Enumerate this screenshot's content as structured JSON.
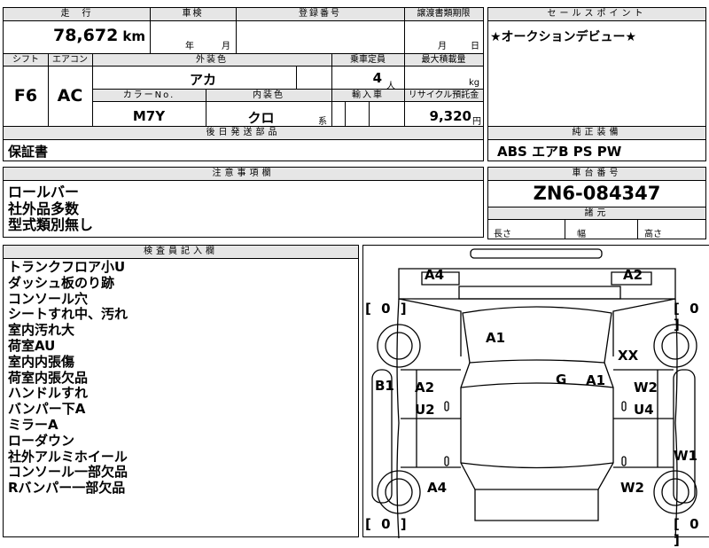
{
  "top": {
    "mileage_header": "走　行",
    "mileage_value": "78,672",
    "mileage_unit": "km",
    "inspection_header": "車検",
    "inspection_year_unit": "年",
    "inspection_month_unit": "月",
    "registration_header": "登録番号",
    "transfer_header": "譲渡書類期限",
    "transfer_month_unit": "月",
    "transfer_day_unit": "日",
    "shift_header": "シフト",
    "shift_value": "F6",
    "ac_header": "エアコン",
    "ac_value": "AC",
    "exterior_color_header": "外装色",
    "exterior_color_value": "アカ",
    "capacity_header": "乗車定員",
    "capacity_value": "4",
    "capacity_unit": "人",
    "max_load_header": "最大積載量",
    "max_load_unit": "kg",
    "color_no_header": "カラーNo.",
    "color_no_value": "M7Y",
    "interior_color_header": "内装色",
    "interior_color_value": "クロ",
    "interior_color_suffix": "系",
    "import_header": "輸入車",
    "recycle_header": "リサイクル預託金",
    "recycle_value": "9,320",
    "recycle_unit": "円"
  },
  "sales_point": {
    "header": "セールスポイント",
    "text": "★オークションデビュー★"
  },
  "shipped_parts": {
    "header": "後日発送部品",
    "text": "保証書"
  },
  "genuine_equipment": {
    "header": "純正装備",
    "text": "ABS エアB PS PW"
  },
  "notes": {
    "header": "注意事項欄",
    "lines": [
      "ロールバー",
      "社外品多数",
      "型式類別無し"
    ]
  },
  "chassis": {
    "header": "車台番号",
    "value": "ZN6-084347"
  },
  "dimensions": {
    "header": "諸元",
    "length_label": "長さ",
    "width_label": "幅",
    "height_label": "高さ"
  },
  "inspector": {
    "header": "検査員記入欄",
    "lines": [
      "トランクフロア小U",
      "ダッシュ板のり跡",
      "コンソール穴",
      "シートすれ中、汚れ",
      "室内汚れ大",
      "荷室AU",
      "室内内張傷",
      "荷室内張欠品",
      "ハンドルすれ",
      "バンパー下A",
      "ミラーA",
      "ローダウン",
      "社外アルミホイール",
      "コンソール一部欠品",
      "Rバンパー一部欠品"
    ]
  },
  "diagram": {
    "marks": [
      "A4",
      "A2",
      "A1",
      "XX",
      "B1",
      "A2",
      "U2",
      "G",
      "A1",
      "W2",
      "U4",
      "W1",
      "A4",
      "W2"
    ],
    "counts": [
      "[ 0 ]",
      "[ 0 ]",
      "[ 0 ]",
      "[ 0 ]"
    ]
  }
}
